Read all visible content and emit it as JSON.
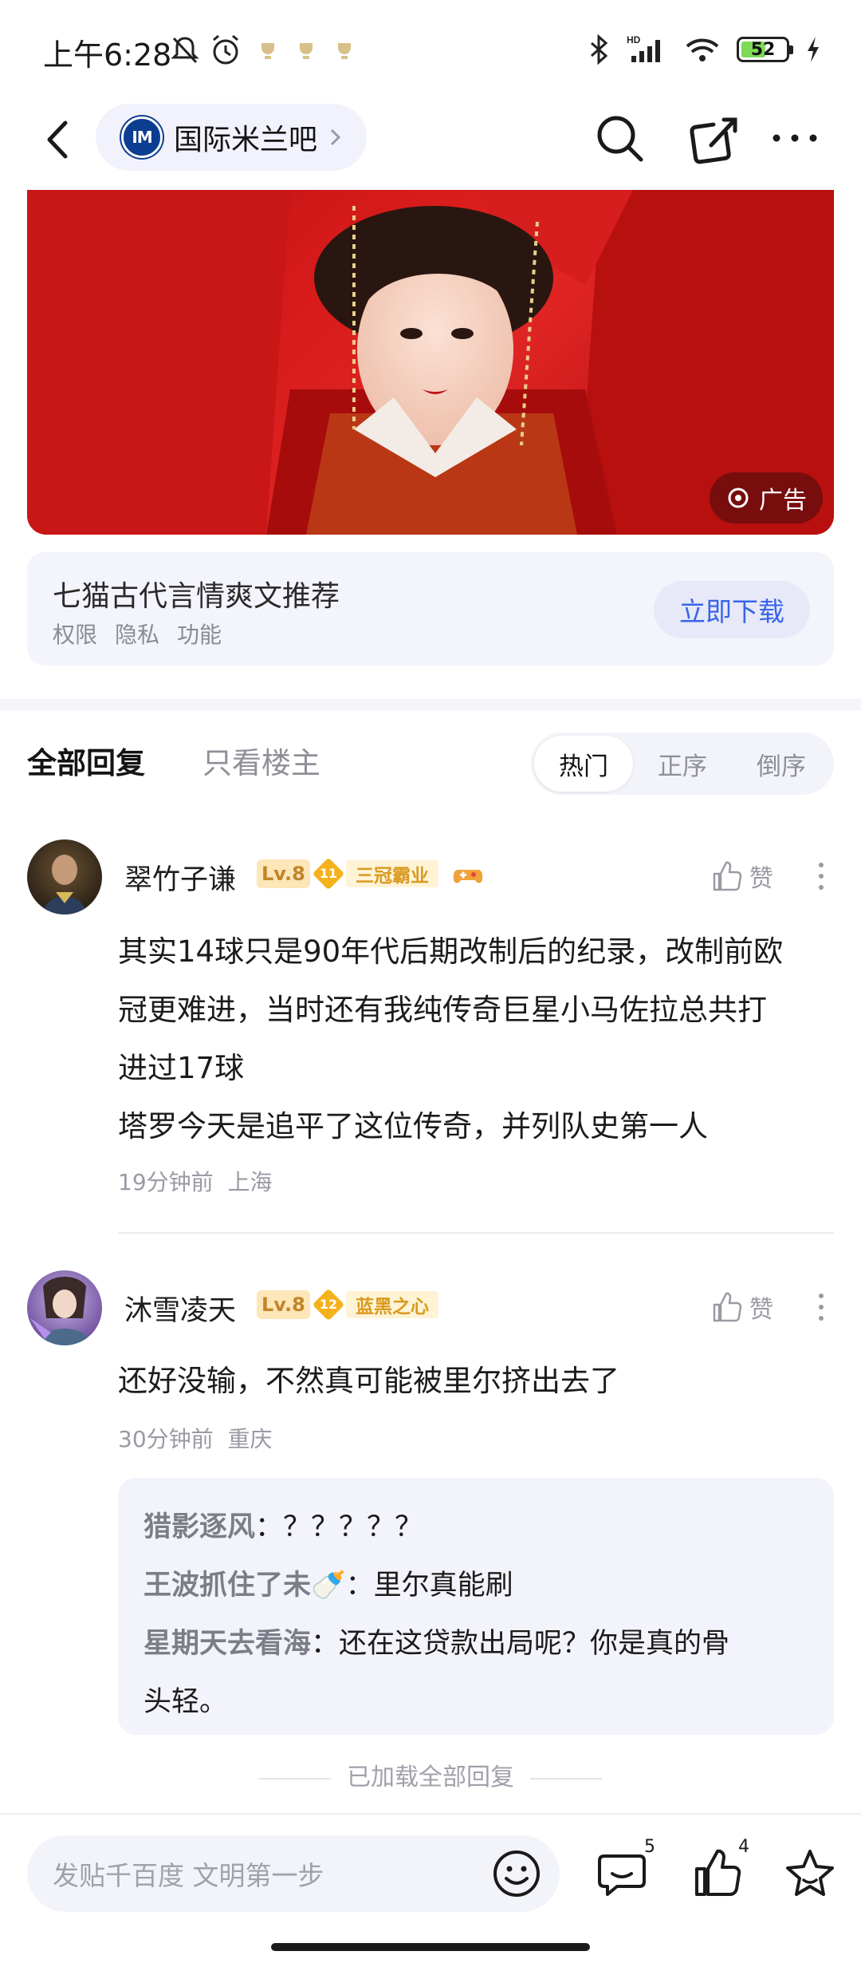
{
  "status_bar": {
    "time": "上午6:28",
    "battery": "52"
  },
  "nav": {
    "forum_logo_text": "IM",
    "forum_name": "国际米兰吧"
  },
  "ad": {
    "badge_label": "广告",
    "title": "七猫古代言情爽文推荐",
    "links": [
      "权限",
      "隐私",
      "功能"
    ],
    "download_label": "立即下载"
  },
  "tabs": {
    "all_replies": "全部回复",
    "op_only": "只看楼主",
    "sort_options": [
      "热门",
      "正序",
      "倒序"
    ],
    "sort_selected": "热门"
  },
  "comments": [
    {
      "username": "翠竹子谦",
      "level": "Lv.8",
      "honor_level": "11",
      "honor_title": "三冠霸业",
      "like_label": "赞",
      "body_lines": [
        "其实14球只是90年代后期改制后的纪录，改制前欧",
        "冠更难进，当时还有我纯传奇巨星小马佐拉总共打",
        "进过17球",
        "塔罗今天是追平了这位传奇，并列队史第一人"
      ],
      "time": "19分钟前",
      "location": "上海"
    },
    {
      "username": "沐雪凌天",
      "level": "Lv.8",
      "honor_level": "12",
      "honor_title": "蓝黑之心",
      "like_label": "赞",
      "body_lines": [
        "还好没输，不然真可能被里尔挤出去了"
      ],
      "time": "30分钟前",
      "location": "重庆",
      "sub_replies": [
        {
          "author": "猎影逐风",
          "text": "？？？？？"
        },
        {
          "author": "王波抓住了未🍼",
          "text": "里尔真能刷"
        },
        {
          "author": "星期天去看海",
          "text": "还在这贷款出局呢？你是真的骨",
          "text_cont": "头轻。"
        }
      ]
    }
  ],
  "loaded_all": "已加载全部回复",
  "bottom_bar": {
    "input_placeholder": "发贴千百度 文明第一步",
    "comment_count": "5",
    "like_count": "4"
  },
  "colors": {
    "accent_blue": "#3964e8",
    "level_badge": "#fde6b8",
    "honor_gold": "#f5b21c",
    "inter_blue": "#0b3d91"
  }
}
